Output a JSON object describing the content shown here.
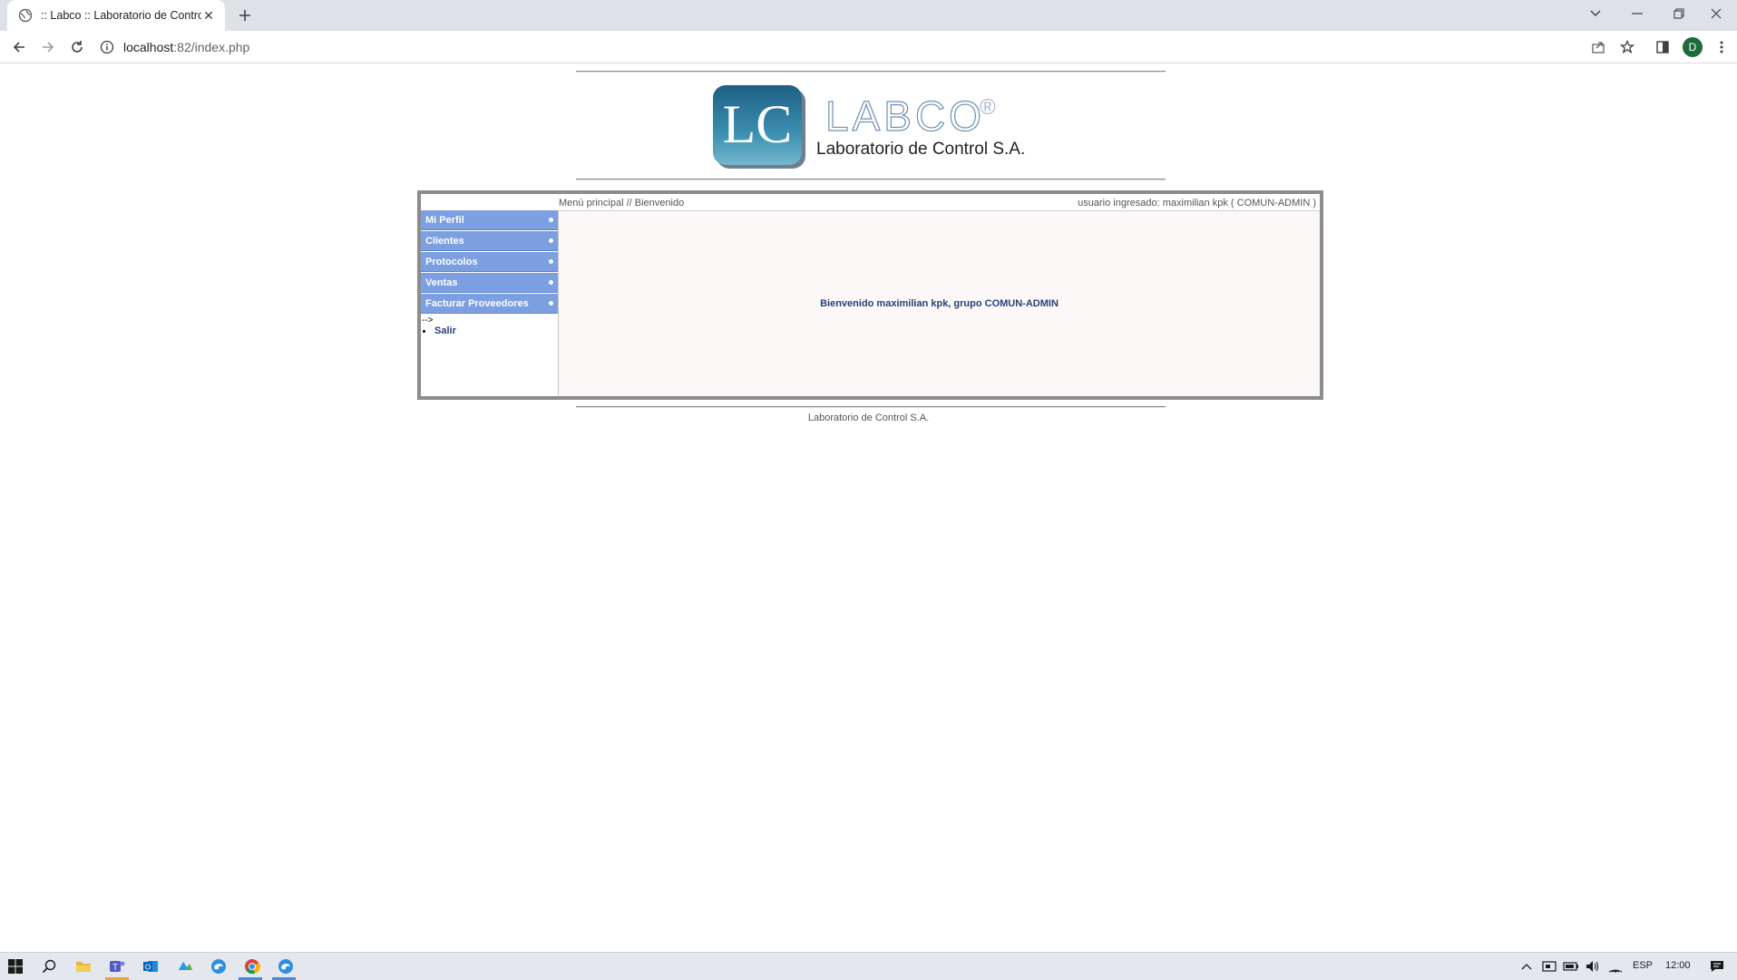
{
  "browser": {
    "tab_title": ":: Labco :: Laboratorio de Control",
    "new_tab_icon": "plus-icon",
    "url_host": "localhost",
    "url_rest": ":82/index.php",
    "profile_initial": "D"
  },
  "page": {
    "brand_name": "LABCO",
    "brand_reg": "®",
    "brand_subtitle": "Laboratorio de Control S.A.",
    "logo_letters": "LC",
    "breadcrumb": "Menú principal // Bienvenido",
    "user_info": "usuario ingresado: maximilian kpk ( COMUN-ADMIN )",
    "menu": [
      {
        "label": "Mi Perfil"
      },
      {
        "label": "Clientes"
      },
      {
        "label": "Protocolos"
      },
      {
        "label": "Ventas"
      },
      {
        "label": "Facturar Proveedores"
      }
    ],
    "stray_text": "-->",
    "logout_label": "Salir",
    "welcome_message": "Bienvenido maximilian kpk, grupo COMUN-ADMIN",
    "footer": "Laboratorio de Control S.A."
  },
  "taskbar": {
    "language": "ESP",
    "clock": "12:00"
  },
  "colors": {
    "menu_bg": "#7b9fe0",
    "welcome_text": "#27407a",
    "content_bg": "#fcf8f7"
  }
}
